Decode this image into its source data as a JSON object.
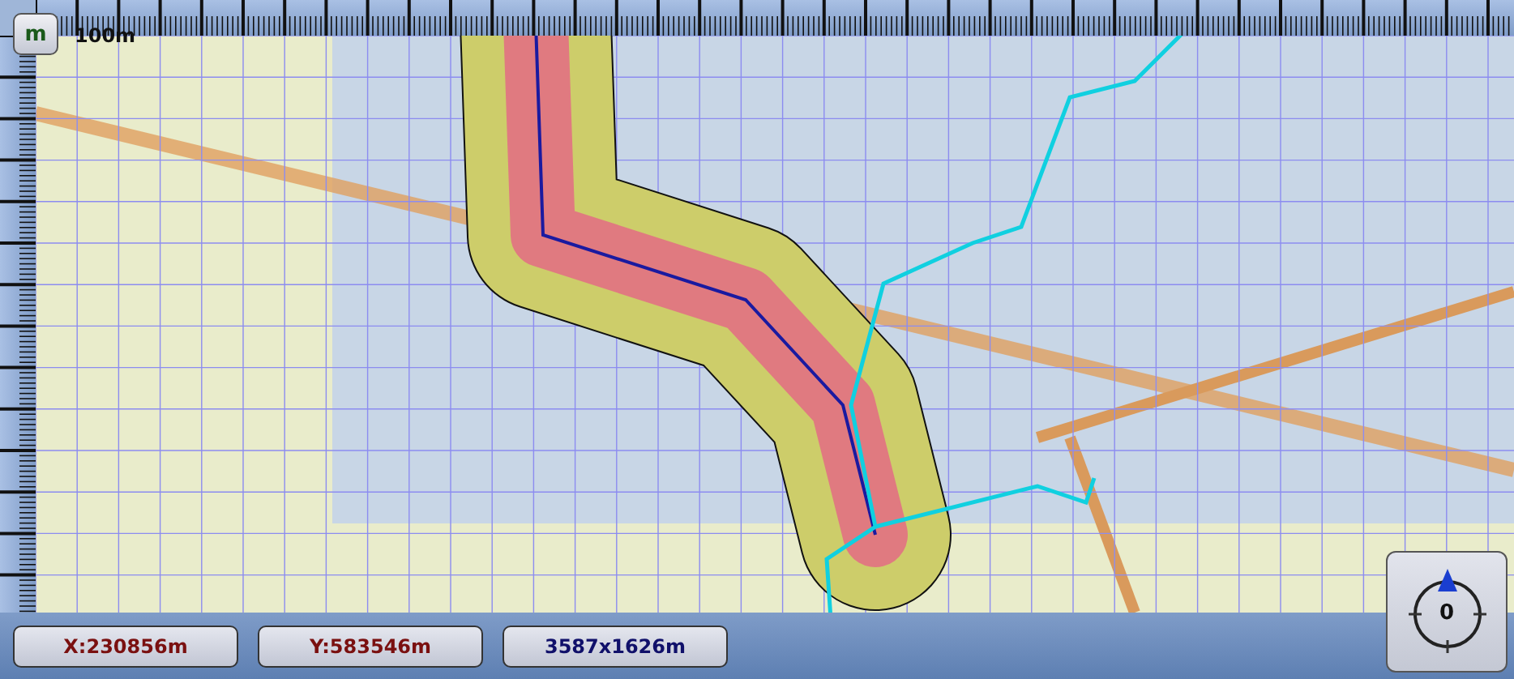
{
  "scale_button": {
    "label": "m"
  },
  "scale_label": "100m",
  "status_bar": [
    {
      "kind": "coordinate",
      "text": "X:230856m"
    },
    {
      "kind": "coordinate",
      "text": "Y:583546m"
    },
    {
      "kind": "extent",
      "text": "3587x1626m"
    }
  ],
  "compass": {
    "heading": "0"
  }
}
